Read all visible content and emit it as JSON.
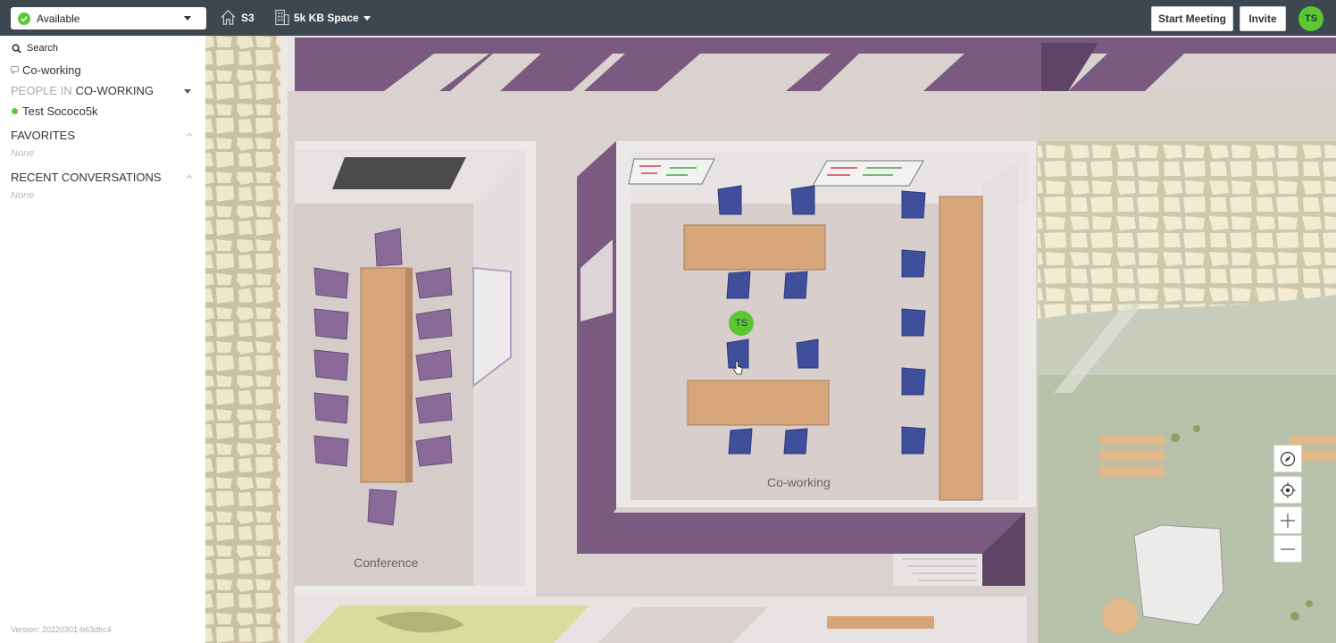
{
  "topbar": {
    "status": "Available",
    "home_label": "S3",
    "space_label": "5k KB Space",
    "start_meeting": "Start Meeting",
    "invite": "Invite",
    "avatar_initials": "TS"
  },
  "sidebar": {
    "search_label": "Search",
    "current_room": "Co-working",
    "people_prefix": "PEOPLE IN",
    "people_room": "CO-WORKING",
    "people": [
      "Test Sococo5k"
    ],
    "favorites_title": "FAVORITES",
    "favorites_empty": "None",
    "recent_title": "RECENT CONVERSATIONS",
    "recent_empty": "None",
    "version": "Version: 20220301-b63dbc4"
  },
  "map": {
    "rooms": {
      "conference": "Conference",
      "coworking": "Co-working"
    },
    "avatar_initials": "TS"
  },
  "colors": {
    "topbar": "#3d474f",
    "status_green": "#5cc733",
    "wall_purple": "#7b5a82",
    "floor": "#d9d2ce",
    "table_wood": "#d7a57a",
    "chair_blue": "#3f4f9c",
    "chair_purple": "#8a6a98",
    "grass": "#b8c1a9",
    "stone": "#e6e0c4"
  }
}
